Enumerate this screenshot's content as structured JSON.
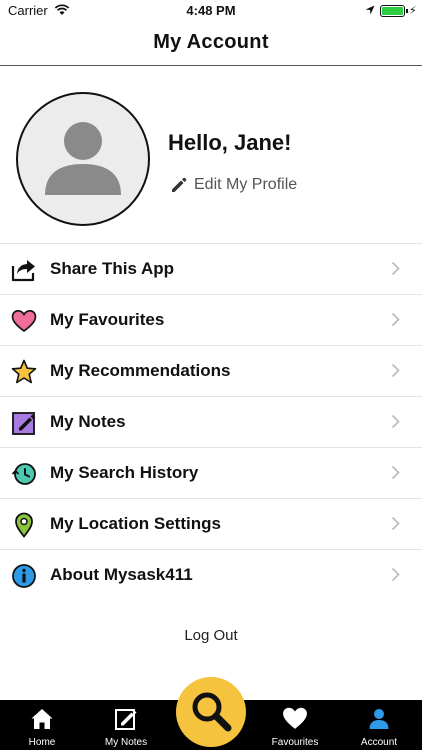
{
  "status_bar": {
    "carrier": "Carrier",
    "time": "4:48 PM",
    "battery_color": "#2ecc40"
  },
  "header": {
    "title": "My Account"
  },
  "profile": {
    "greeting": "Hello, Jane!",
    "edit_label": "Edit My Profile",
    "avatar_icon": "person-silhouette-icon"
  },
  "menu": {
    "items": [
      {
        "label": "Share This App",
        "icon": "share-icon"
      },
      {
        "label": "My Favourites",
        "icon": "heart-icon",
        "color": "#f06e9a"
      },
      {
        "label": "My Recommendations",
        "icon": "star-icon",
        "color": "#f6c33e"
      },
      {
        "label": "My Notes",
        "icon": "note-edit-icon",
        "color": "#a97be0"
      },
      {
        "label": "My Search History",
        "icon": "history-icon",
        "color": "#4cc9b0"
      },
      {
        "label": "My Location Settings",
        "icon": "location-pin-icon",
        "color": "#8cc63f"
      },
      {
        "label": "About Mysask411",
        "icon": "info-icon",
        "color": "#2f9be8"
      }
    ]
  },
  "logout_label": "Log Out",
  "tab_bar": {
    "tabs": [
      {
        "label": "Home",
        "icon": "home-icon"
      },
      {
        "label": "My Notes",
        "icon": "notes-icon"
      },
      {
        "label": "Favourites",
        "icon": "heart-icon"
      },
      {
        "label": "Account",
        "icon": "account-icon",
        "active": true
      }
    ],
    "search_icon": "search-icon",
    "fab_color": "#f6c33e",
    "active_color": "#2f9be8"
  }
}
